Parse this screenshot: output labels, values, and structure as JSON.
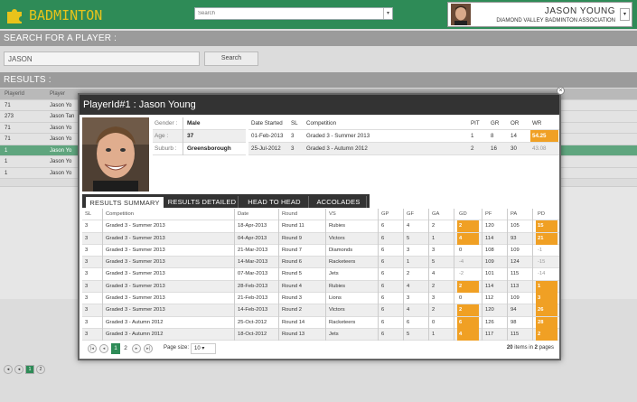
{
  "app": {
    "brand": "BADMINTON",
    "search_placeholder": "Search",
    "user_name": "JASON YOUNG",
    "user_org": "DIAMOND VALLEY BADMINTON ASSOCIATION"
  },
  "search_section": {
    "title": "SEARCH FOR A PLAYER :",
    "query": "JASON",
    "button": "Search"
  },
  "results_section": {
    "title": "RESULTS :",
    "columns": [
      "PlayerId",
      "Player"
    ],
    "rows": [
      {
        "id": "71",
        "name": "Jason Yo"
      },
      {
        "id": "273",
        "name": "Jason Tan"
      },
      {
        "id": "71",
        "name": "Jason Yo"
      },
      {
        "id": "71",
        "name": "Jason Yo"
      },
      {
        "id": "1",
        "name": "Jason Yo"
      },
      {
        "id": "1",
        "name": "Jason Yo"
      },
      {
        "id": "1",
        "name": "Jason Yo"
      }
    ],
    "selected_index": 4,
    "pager": {
      "pages": [
        "1",
        "2"
      ]
    }
  },
  "modal": {
    "title": "PlayerId#1 : Jason Young",
    "close": "×",
    "info": [
      {
        "label": "Gender :",
        "value": "Male"
      },
      {
        "label": "Age :",
        "value": "37"
      },
      {
        "label": "Suburb :",
        "value": "Greensborough"
      }
    ],
    "competitions": {
      "headers": [
        "Date Started",
        "SL",
        "Competition",
        "PIT",
        "GR",
        "OR",
        "WR"
      ],
      "rows": [
        [
          "01-Feb-2013",
          "3",
          "Graded 3 - Summer 2013",
          "1",
          "8",
          "14",
          "54.25"
        ],
        [
          "25-Jul-2012",
          "3",
          "Graded 3 - Autumn 2012",
          "2",
          "16",
          "30",
          "43.08"
        ]
      ]
    },
    "tabs": [
      "RESULTS SUMMARY",
      "RESULTS DETAILED",
      "HEAD TO HEAD",
      "ACCOLADES"
    ],
    "results": {
      "headers": [
        "SL",
        "Competition",
        "Date",
        "Round",
        "VS",
        "GP",
        "GF",
        "GA",
        "GD",
        "PF",
        "PA",
        "PD"
      ],
      "rows": [
        [
          "3",
          "Graded 3 - Summer 2013",
          "18-Apr-2013",
          "Round 11",
          "Rubies",
          "6",
          "4",
          "2",
          "2",
          "120",
          "105",
          "15"
        ],
        [
          "3",
          "Graded 3 - Summer 2013",
          "04-Apr-2013",
          "Round 9",
          "Victors",
          "6",
          "5",
          "1",
          "4",
          "114",
          "93",
          "21"
        ],
        [
          "3",
          "Graded 3 - Summer 2013",
          "21-Mar-2013",
          "Round 7",
          "Diamonds",
          "6",
          "3",
          "3",
          "0",
          "108",
          "109",
          "-1"
        ],
        [
          "3",
          "Graded 3 - Summer 2013",
          "14-Mar-2013",
          "Round 6",
          "Racketeers",
          "6",
          "1",
          "5",
          "-4",
          "109",
          "124",
          "-15"
        ],
        [
          "3",
          "Graded 3 - Summer 2013",
          "07-Mar-2013",
          "Round 5",
          "Jets",
          "6",
          "2",
          "4",
          "-2",
          "101",
          "115",
          "-14"
        ],
        [
          "3",
          "Graded 3 - Summer 2013",
          "28-Feb-2013",
          "Round 4",
          "Rubies",
          "6",
          "4",
          "2",
          "2",
          "114",
          "113",
          "1"
        ],
        [
          "3",
          "Graded 3 - Summer 2013",
          "21-Feb-2013",
          "Round 3",
          "Lions",
          "6",
          "3",
          "3",
          "0",
          "112",
          "109",
          "3"
        ],
        [
          "3",
          "Graded 3 - Summer 2013",
          "14-Feb-2013",
          "Round 2",
          "Victors",
          "6",
          "4",
          "2",
          "2",
          "120",
          "94",
          "26"
        ],
        [
          "3",
          "Graded 3 - Autumn 2012",
          "25-Oct-2012",
          "Round 14",
          "Racketeers",
          "6",
          "6",
          "0",
          "6",
          "126",
          "98",
          "28"
        ],
        [
          "3",
          "Graded 3 - Autumn 2012",
          "18-Oct-2012",
          "Round 13",
          "Jets",
          "6",
          "5",
          "1",
          "4",
          "117",
          "115",
          "2"
        ]
      ]
    },
    "pager": {
      "first": "|◂",
      "prev": "◂",
      "pages": [
        "1",
        "2"
      ],
      "next": "▸",
      "last": "▸|",
      "page_size_label": "Page size:",
      "page_size": "10",
      "items_count": "20",
      "items_text": "items in",
      "pages_count": "2",
      "pages_text": "pages"
    }
  },
  "colors": {
    "header": "#2e8b57",
    "accent": "#f0a024",
    "brand_text": "#e8c31b"
  }
}
